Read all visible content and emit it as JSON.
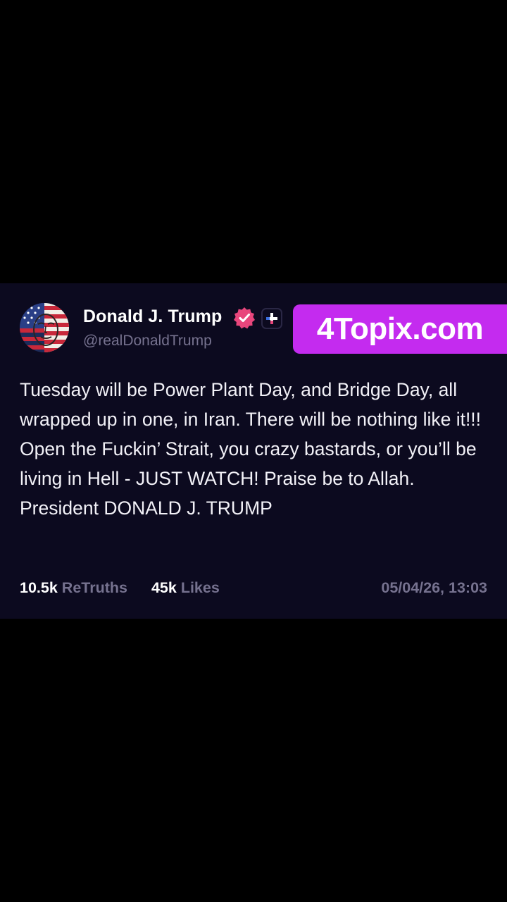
{
  "post": {
    "display_name": "Donald J. Trump",
    "handle": "@realDonaldTrump",
    "body": "Tuesday will be Power Plant Day, and Bridge Day, all wrapped up in one, in Iran. There will be nothing like it!!! Open the Fuckin’ Strait, you crazy bastards, or you’ll be living in Hell - JUST WATCH! Praise be to Allah. President DONALD J. TRUMP",
    "retruths_count": "10.5k",
    "retruths_label": "ReTruths",
    "likes_count": "45k",
    "likes_label": "Likes",
    "timestamp": "05/04/26, 13:03",
    "verified_icon": "verified-check-icon",
    "plus_icon": "plus-icon"
  },
  "watermark": {
    "text": "4Topix.com"
  },
  "colors": {
    "page_background": "#000000",
    "card_background": "#0c0a1f",
    "verified_badge": "#e8467c",
    "watermark_background": "#c42bef",
    "muted_text": "#76728f"
  }
}
